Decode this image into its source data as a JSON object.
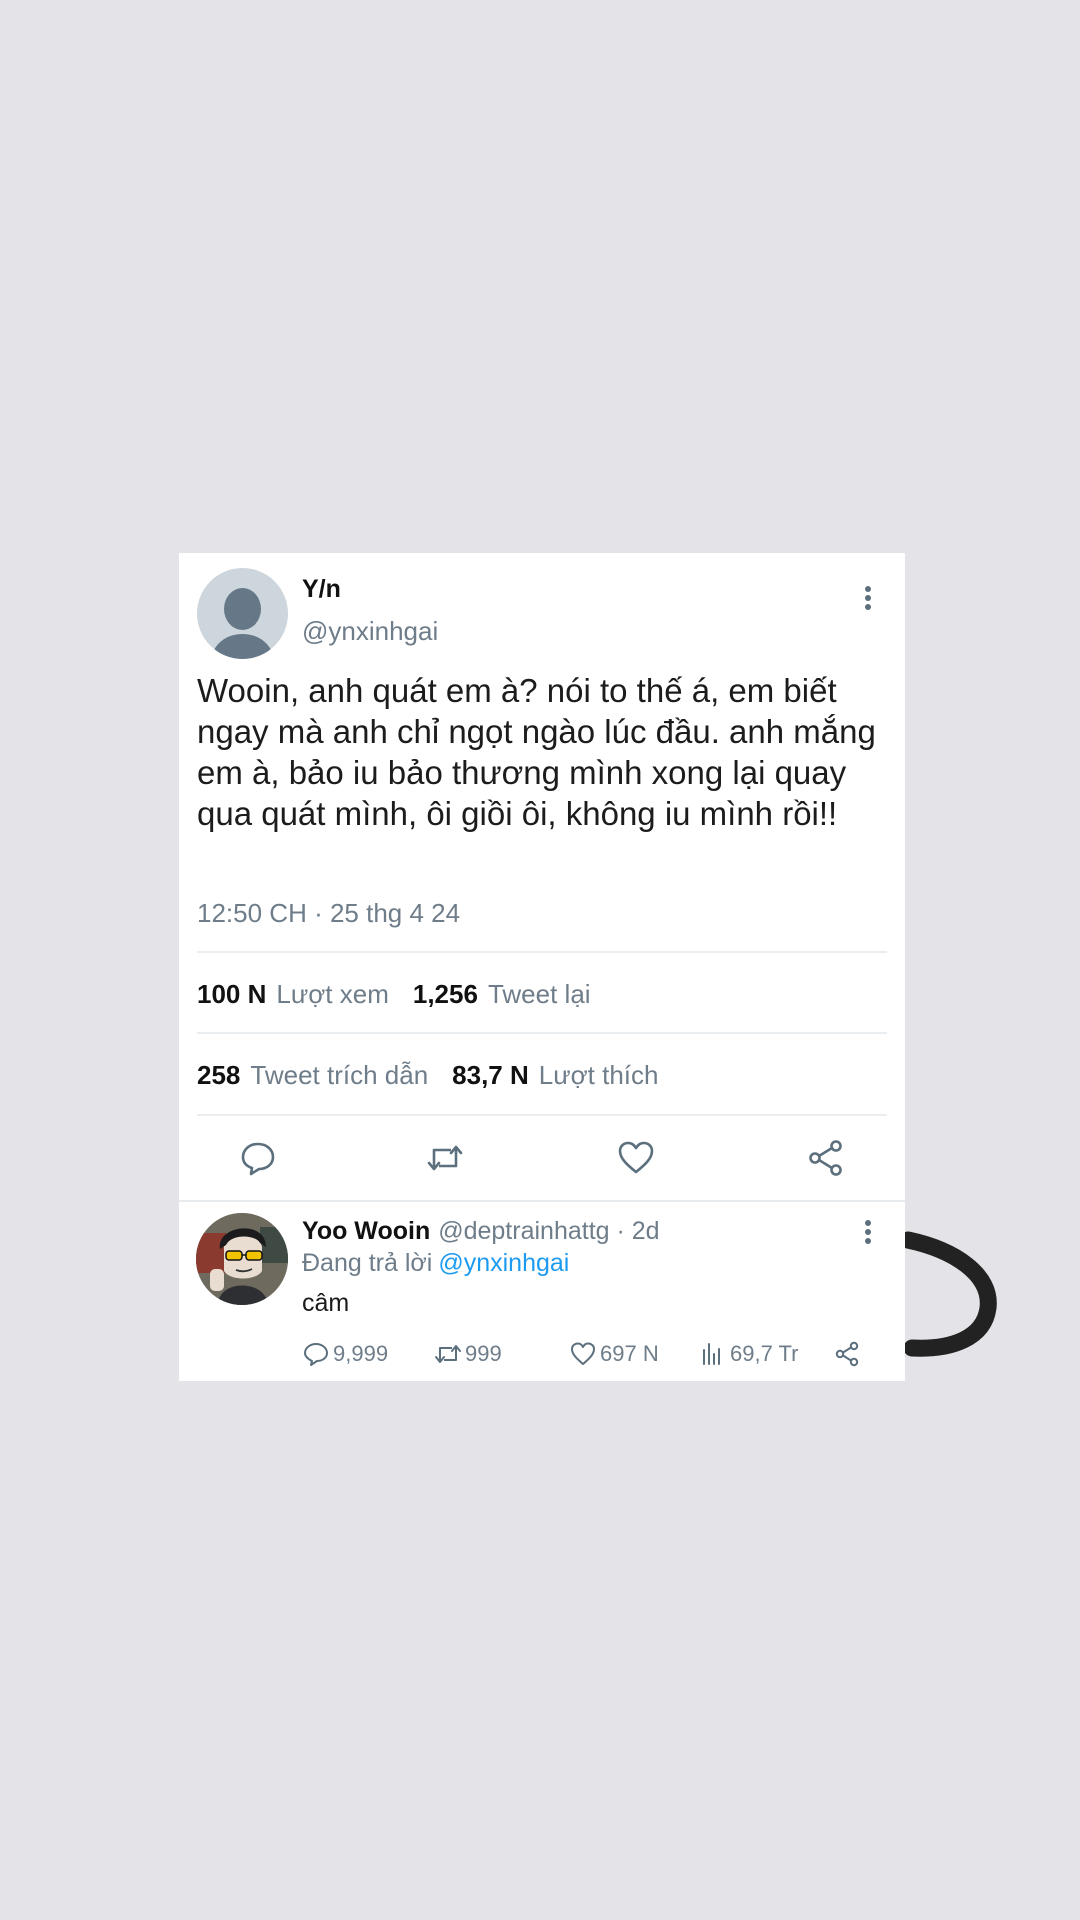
{
  "tweet": {
    "author_name": "Y/n",
    "author_handle": "@ynxinhgai",
    "text": "Wooin, anh quát em à? nói to thế á, em biết ngay mà anh chỉ ngọt ngào lúc đầu. anh mắng em à, bảo iu bảo thương mình xong lại quay qua quát mình, ôi giồi ôi, không iu mình rồi!!",
    "timestamp": "12:50 CH · 25 thg 4 24",
    "stats": {
      "views_count": "100 N",
      "views_label": "Lượt xem",
      "retweets_count": "1,256",
      "retweets_label": "Tweet lại",
      "quotes_count": "258",
      "quotes_label": "Tweet trích dẫn",
      "likes_count": "83,7 N",
      "likes_label": "Lượt thích"
    },
    "action_icons": [
      "reply-icon",
      "retweet-icon",
      "like-icon",
      "share-icon"
    ]
  },
  "reply": {
    "author_name": "Yoo Wooin",
    "author_handle_time": "@deptrainhattg · 2d",
    "replying_prefix": "Đang trả lời",
    "replying_to": "@ynxinhgai",
    "text": "câm",
    "actions": {
      "replies": "9,999",
      "retweets": "999",
      "likes": "697 N",
      "views": "69,7 Tr"
    }
  },
  "colors": {
    "background": "#e3e3e8",
    "card": "#ffffff",
    "secondary_text": "#6e7d89",
    "mention": "#1d9bf0",
    "icon": "#5b6f7d"
  }
}
